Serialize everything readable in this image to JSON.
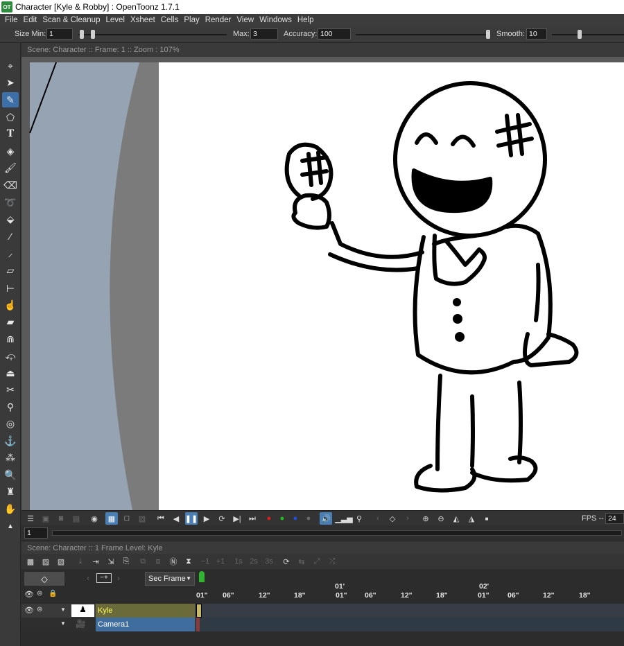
{
  "window": {
    "title": "Character [Kyle & Robby] : OpenToonz 1.7.1",
    "app_icon_text": "OT"
  },
  "menu": [
    "File",
    "Edit",
    "Scan & Cleanup",
    "Level",
    "Xsheet",
    "Cells",
    "Play",
    "Render",
    "View",
    "Windows",
    "Help"
  ],
  "tool_options": {
    "size_min_label": "Size Min:",
    "size_min_value": "1",
    "max_label": "Max:",
    "max_value": "3",
    "accuracy_label": "Accuracy:",
    "accuracy_value": "100",
    "smooth_label": "Smooth:",
    "smooth_value": "10"
  },
  "tools": [
    "animate-tool",
    "selection-tool",
    "brush-tool",
    "geometric-tool",
    "type-tool",
    "fill-tool",
    "paint-brush-tool",
    "eraser-tool",
    "tape-tool",
    "style-picker-tool",
    "rgb-picker-tool",
    "ruler-tool",
    "control-point-editor-tool",
    "pinch-tool",
    "pump-tool",
    "magnet-tool",
    "bender-tool",
    "iron-tool",
    "cutter-tool",
    "skeleton-tool",
    "tracker-tool",
    "hook-tool",
    "plastic-tool",
    "zoom-tool",
    "rotate-tool",
    "hand-tool"
  ],
  "viewer": {
    "header": "Scene: Character  ::  Frame: 1  ::  Zoom : 107%",
    "fps_label": "FPS -- /",
    "fps_value": "24",
    "current_frame": "1"
  },
  "xsheet": {
    "header": "Scene: Character  ::  1 Frame  Level: Kyle",
    "frame_display": "Sec Frame",
    "ruler_seconds": [
      "01'",
      "02'"
    ],
    "ruler_frames": [
      "01\"",
      "06\"",
      "12\"",
      "18\"",
      "01\"",
      "06\"",
      "12\"",
      "18\"",
      "01\"",
      "06\"",
      "12\"",
      "18\""
    ],
    "layers": [
      {
        "name": "Kyle",
        "color": "#6b6a3a",
        "text_color": "#ffff66"
      },
      {
        "name": "Camera1",
        "color": "#3f6d9e",
        "text_color": "#ffffff"
      }
    ]
  },
  "colors": {
    "accent": "#3d6fa8",
    "panel": "#3a3a3a",
    "canvas": "#ffffff"
  }
}
